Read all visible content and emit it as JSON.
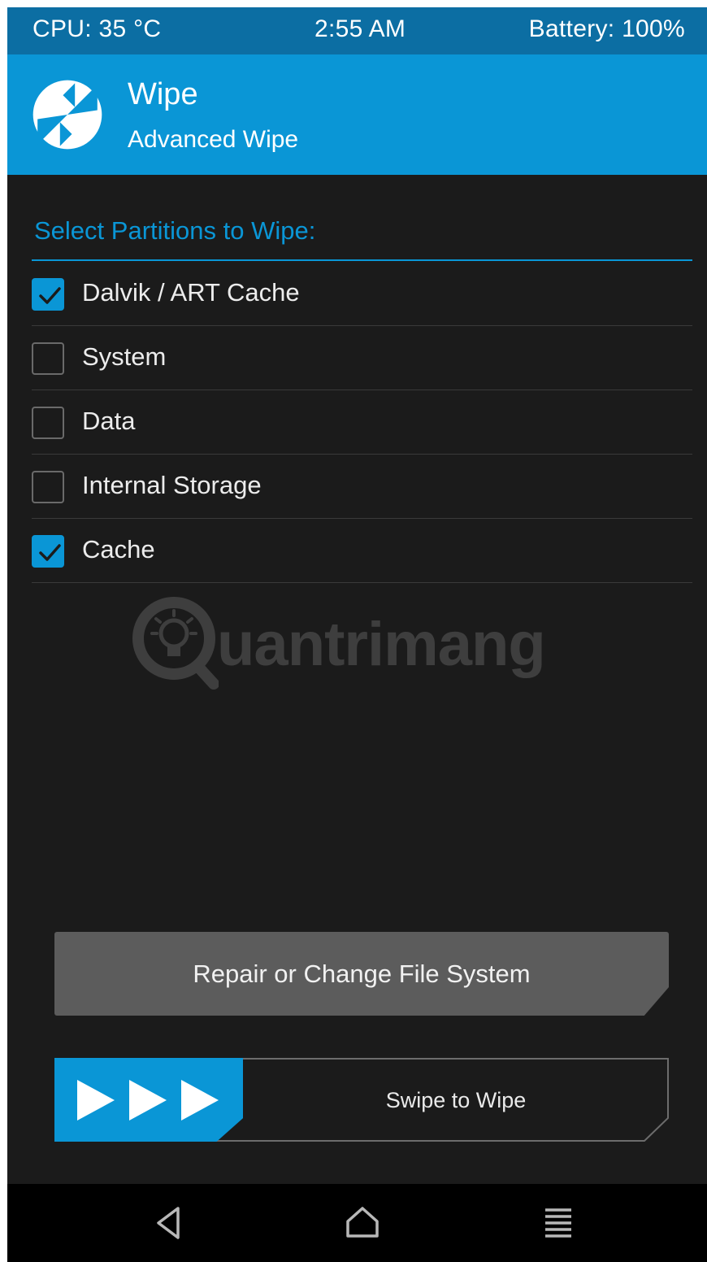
{
  "status_bar": {
    "cpu": "CPU: 35 °C",
    "time": "2:55 AM",
    "battery": "Battery: 100%"
  },
  "header": {
    "title": "Wipe",
    "subtitle": "Advanced Wipe",
    "logo_icon": "twrp-logo-icon"
  },
  "section": {
    "title": "Select Partitions to Wipe:"
  },
  "partitions": [
    {
      "label": "Dalvik / ART Cache",
      "checked": true
    },
    {
      "label": "System",
      "checked": false
    },
    {
      "label": "Data",
      "checked": false
    },
    {
      "label": "Internal Storage",
      "checked": false
    },
    {
      "label": "Cache",
      "checked": true
    }
  ],
  "watermark": {
    "text": "uantrimang",
    "icon": "lightbulb-q-icon"
  },
  "buttons": {
    "repair_label": "Repair or Change File System",
    "swipe_label": "Swipe to Wipe",
    "swipe_icon": "triple-arrow-right-icon"
  },
  "nav": {
    "back_icon": "back-triangle-icon",
    "home_icon": "home-icon",
    "menu_icon": "menu-lines-icon"
  },
  "colors": {
    "accent": "#0a96d6",
    "status_bar": "#0c6ea3",
    "background": "#1b1b1b",
    "button_gray": "#5c5c5c"
  }
}
